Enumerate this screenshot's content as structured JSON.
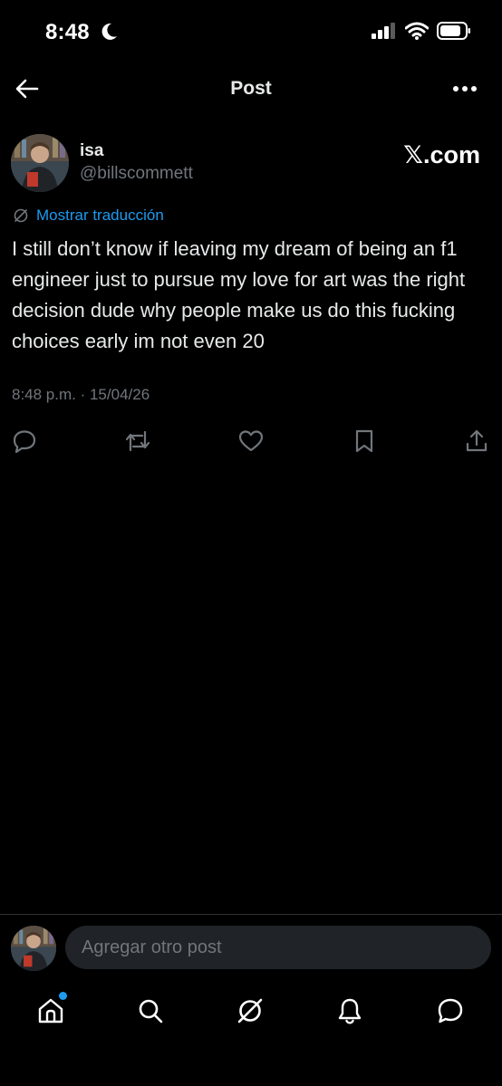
{
  "status_bar": {
    "time": "8:48"
  },
  "header": {
    "title": "Post"
  },
  "post": {
    "author_name": "isa",
    "author_handle": "@billscommett",
    "watermark": "𝕏.com",
    "translate_label": "Mostrar traducción",
    "text": "I still don’t know if leaving my dream of being an f1 engineer just to pursue my love for art was the right decision dude why people make us do this fucking choices early im not even 20",
    "timestamp": "8:48 p.m. · 15/04/26"
  },
  "composer": {
    "placeholder": "Agregar otro post"
  },
  "colors": {
    "accent": "#1d9bf0",
    "muted": "#71767b",
    "text": "#e7e9ea",
    "background": "#000000"
  }
}
